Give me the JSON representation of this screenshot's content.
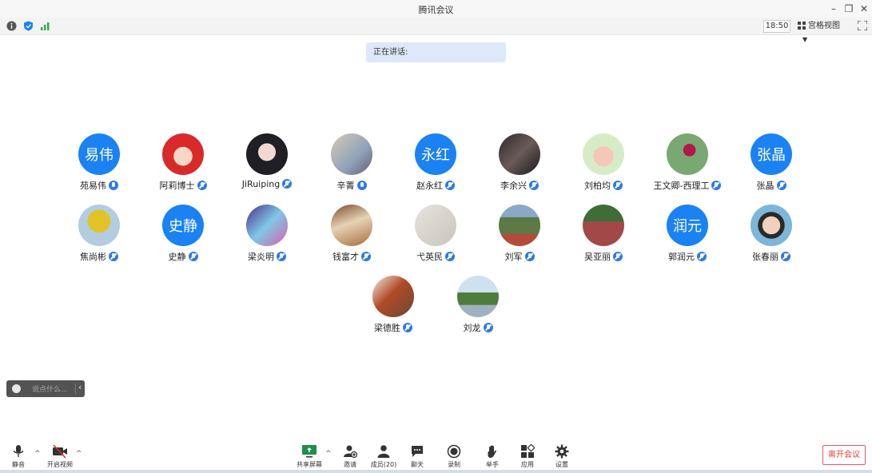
{
  "window": {
    "title": "腾讯会议"
  },
  "infobar": {
    "time": "18:50",
    "view_label": "宫格视图"
  },
  "speaking": {
    "label": "正在讲话:"
  },
  "participants": [
    {
      "name": "苑易伟",
      "avatar_text": "易伟",
      "avatar": "text",
      "mic": "on"
    },
    {
      "name": "阿莉博士",
      "avatar_text": "",
      "avatar": "cartoon-red",
      "mic": "muted"
    },
    {
      "name": "JiRuiping",
      "avatar_text": "",
      "avatar": "photo-dark",
      "mic": "muted"
    },
    {
      "name": "辛菁",
      "avatar_text": "",
      "avatar": "photo-art",
      "mic": "on"
    },
    {
      "name": "赵永红",
      "avatar_text": "永红",
      "avatar": "text",
      "mic": "muted"
    },
    {
      "name": "李余兴",
      "avatar_text": "",
      "avatar": "photo-w",
      "mic": "muted"
    },
    {
      "name": "刘柏均",
      "avatar_text": "",
      "avatar": "cartoon-pig",
      "mic": "muted"
    },
    {
      "name": "王文卿-西理工",
      "avatar_text": "",
      "avatar": "photo-flower",
      "mic": "muted"
    },
    {
      "name": "张晶",
      "avatar_text": "张晶",
      "avatar": "text",
      "mic": "muted"
    },
    {
      "name": "焦尚彬",
      "avatar_text": "",
      "avatar": "photo-yellow",
      "mic": "muted"
    },
    {
      "name": "史静",
      "avatar_text": "史静",
      "avatar": "text",
      "mic": "muted"
    },
    {
      "name": "梁炎明",
      "avatar_text": "",
      "avatar": "photo-anime",
      "mic": "muted"
    },
    {
      "name": "钱富才",
      "avatar_text": "",
      "avatar": "photo-room",
      "mic": "muted"
    },
    {
      "name": "弋英民",
      "avatar_text": "",
      "avatar": "photo-calligraphy",
      "mic": "muted"
    },
    {
      "name": "刘军",
      "avatar_text": "",
      "avatar": "photo-outdoor",
      "mic": "muted"
    },
    {
      "name": "吴亚丽",
      "avatar_text": "",
      "avatar": "photo-path",
      "mic": "muted"
    },
    {
      "name": "郭润元",
      "avatar_text": "润元",
      "avatar": "text",
      "mic": "muted"
    },
    {
      "name": "张春丽",
      "avatar_text": "",
      "avatar": "photo-portrait",
      "mic": "muted"
    },
    {
      "name": "梁德胜",
      "avatar_text": "",
      "avatar": "photo-leaves",
      "mic": "muted"
    },
    {
      "name": "刘龙",
      "avatar_text": "",
      "avatar": "photo-landscape",
      "mic": "muted"
    }
  ],
  "chat": {
    "placeholder": "说点什么..."
  },
  "toolbar": {
    "mute": "静音",
    "video": "开启视频",
    "share": "共享屏幕",
    "invite": "邀请",
    "members": "成员(20)",
    "chat": "聊天",
    "record": "录制",
    "raise_hand": "举手",
    "apps": "应用",
    "settings": "设置",
    "leave": "离开会议"
  }
}
